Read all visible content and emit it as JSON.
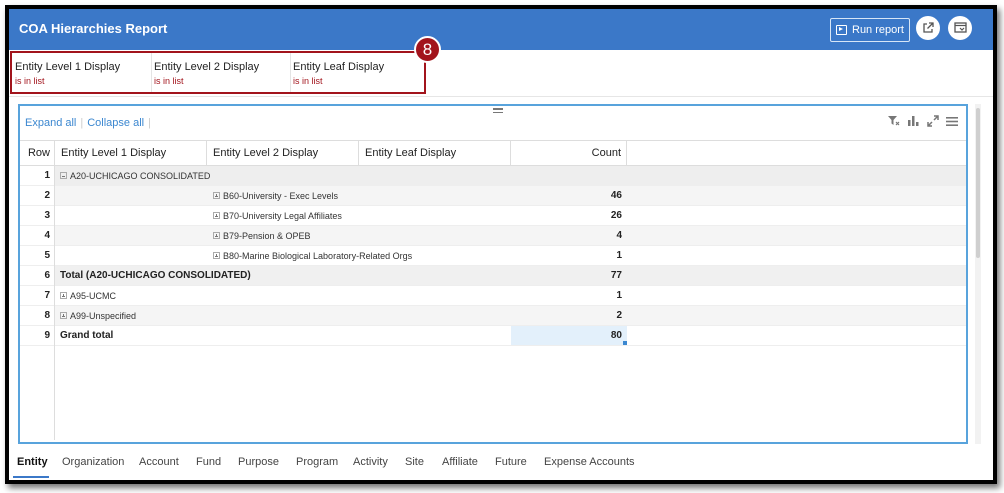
{
  "app": {
    "title": "COA Hierarchies Report"
  },
  "toolbar": {
    "run_label": "Run report"
  },
  "filters": [
    {
      "label": "Entity Level 1 Display",
      "state": "is in list"
    },
    {
      "label": "Entity Level 2 Display",
      "state": "is in list"
    },
    {
      "label": "Entity Leaf Display",
      "state": "is in list"
    }
  ],
  "callout": {
    "number": "8"
  },
  "panel": {
    "expand_all": "Expand all",
    "collapse_all": "Collapse all"
  },
  "table": {
    "headers": {
      "row": "Row",
      "l1": "Entity Level 1 Display",
      "l2": "Entity Level 2 Display",
      "leaf": "Entity Leaf Display",
      "count": "Count"
    },
    "rows": [
      {
        "num": "1",
        "l1": "A20-UCHICAGO CONSOLIDATED",
        "l2": "",
        "count": ""
      },
      {
        "num": "2",
        "l1": "",
        "l2": "B60-University - Exec Levels",
        "count": "46"
      },
      {
        "num": "3",
        "l1": "",
        "l2": "B70-University Legal Affiliates",
        "count": "26"
      },
      {
        "num": "4",
        "l1": "",
        "l2": "B79-Pension & OPEB",
        "count": "4"
      },
      {
        "num": "5",
        "l1": "",
        "l2": "B80-Marine Biological Laboratory-Related Orgs",
        "count": "1"
      },
      {
        "num": "6",
        "l1": "Total (A20-UCHICAGO CONSOLIDATED)",
        "l2": "",
        "count": "77"
      },
      {
        "num": "7",
        "l1": "A95-UCMC",
        "l2": "",
        "count": "1"
      },
      {
        "num": "8",
        "l1": "A99-Unspecified",
        "l2": "",
        "count": "2"
      },
      {
        "num": "9",
        "l1": "Grand total",
        "l2": "",
        "count": "80"
      }
    ]
  },
  "tabs": [
    "Entity",
    "Organization",
    "Account",
    "Fund",
    "Purpose",
    "Program",
    "Activity",
    "Site",
    "Affiliate",
    "Future",
    "Expense Accounts"
  ],
  "colors": {
    "header": "#3b78c8",
    "callout": "#a2141c",
    "panel_border": "#58a3dc",
    "link": "#3b87d0"
  }
}
